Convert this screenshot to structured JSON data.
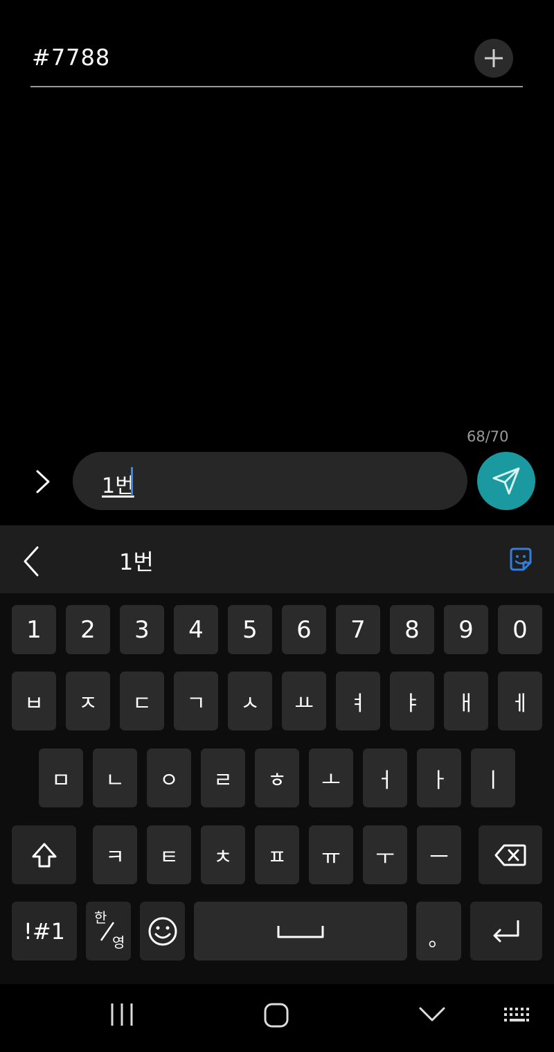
{
  "recipient": {
    "number": "#7788"
  },
  "composer": {
    "counter": "68/70",
    "message": "1번"
  },
  "keyboard": {
    "suggestion": "1번",
    "number_row": [
      "1",
      "2",
      "3",
      "4",
      "5",
      "6",
      "7",
      "8",
      "9",
      "0"
    ],
    "row1": [
      "ㅂ",
      "ㅈ",
      "ㄷ",
      "ㄱ",
      "ㅅ",
      "ㅛ",
      "ㅕ",
      "ㅑ",
      "ㅐ",
      "ㅔ"
    ],
    "row2": [
      "ㅁ",
      "ㄴ",
      "ㅇ",
      "ㄹ",
      "ㅎ",
      "ㅗ",
      "ㅓ",
      "ㅏ",
      "ㅣ"
    ],
    "row3": [
      "ㅋ",
      "ㅌ",
      "ㅊ",
      "ㅍ",
      "ㅠ",
      "ㅜ",
      "ㅡ"
    ],
    "symbols_label": "!#1",
    "lang_top": "한",
    "lang_bottom": "영",
    "period": "。"
  },
  "colors": {
    "accent": "#1a9aa0",
    "cursor": "#3b87e8",
    "sticker": "#2f7fe0"
  },
  "icons": [
    "plus-icon",
    "chevron-right-icon",
    "send-icon",
    "chevron-left-icon",
    "sticker-icon",
    "shift-icon",
    "backspace-icon",
    "emoji-icon",
    "space-icon",
    "enter-icon",
    "recents-icon",
    "home-icon",
    "hide-keyboard-icon",
    "keyboard-icon"
  ]
}
